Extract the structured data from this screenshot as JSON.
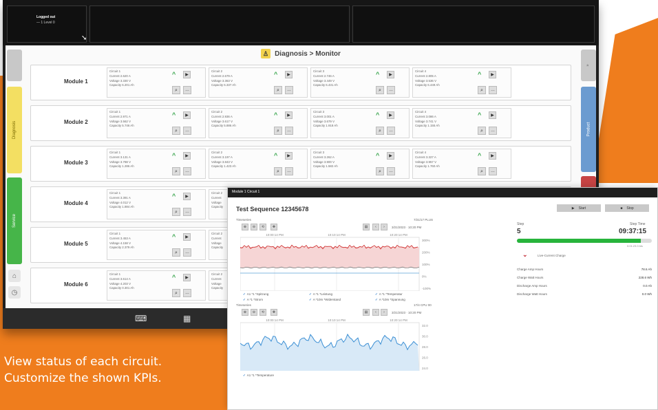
{
  "colors": {
    "accent_orange": "#ef7d1d",
    "tab_yellow": "#f3df62",
    "tab_green": "#46b549",
    "tab_blue": "#6b9bd0",
    "tab_red": "#c74444",
    "up_green": "#2ea043",
    "progress_green": "#27b43c",
    "line_red": "#d23c3c",
    "line_blue": "#3b8fd4"
  },
  "topbar": {
    "status_title": "Logged out",
    "status_sub": "— 1 Level 0"
  },
  "screen": {
    "breadcrumb": "Diagnosis > Monitor"
  },
  "side_tabs": {
    "left_yellow": "Diagnosis",
    "left_green": "Service",
    "right_blue": "Product"
  },
  "modules": [
    {
      "name": "Module 1",
      "circuits": [
        {
          "title": "Circuit 1",
          "current": "Current 2.620 A",
          "voltage": "Voltage 3.330 V",
          "capacity": "Capacity 6.201 Ah"
        },
        {
          "title": "Circuit 2",
          "current": "Current 2.679 A",
          "voltage": "Voltage 3.363 V",
          "capacity": "Capacity 6.337 Ah"
        },
        {
          "title": "Circuit 3",
          "current": "Current 2.746 A",
          "voltage": "Voltage 3.449 V",
          "capacity": "Capacity 6.431 Ah"
        },
        {
          "title": "Circuit 4",
          "current": "Current 2.805 A",
          "voltage": "Voltage 3.536 V",
          "capacity": "Capacity 6.449 Ah"
        }
      ]
    },
    {
      "name": "Module 2",
      "circuits": [
        {
          "title": "Circuit 1",
          "current": "Current 2.971 A",
          "voltage": "Voltage 3.562 V",
          "capacity": "Capacity 5.746 Ah"
        },
        {
          "title": "Circuit 2",
          "current": "Current 2.936 A",
          "voltage": "Voltage 3.617 V",
          "capacity": "Capacity 5.886 Ah"
        },
        {
          "title": "Circuit 3",
          "current": "Current 3.001 A",
          "voltage": "Voltage 3.679 V",
          "capacity": "Capacity 1.918 Ah"
        },
        {
          "title": "Circuit 4",
          "current": "Current 3.086 A",
          "voltage": "Voltage 3.741 V",
          "capacity": "Capacity 1.155 Ah"
        }
      ]
    },
    {
      "name": "Module 3",
      "circuits": [
        {
          "title": "Circuit 1",
          "current": "Current 3.131 A",
          "voltage": "Voltage 3.788 V",
          "capacity": "Capacity 1.286 Ah"
        },
        {
          "title": "Circuit 2",
          "current": "Current 3.197 A",
          "voltage": "Voltage 3.843 V",
          "capacity": "Capacity 1.423 Ah"
        },
        {
          "title": "Circuit 3",
          "current": "Current 3.262 A",
          "voltage": "Voltage 3.900 V",
          "capacity": "Capacity 1.582 Ah"
        },
        {
          "title": "Circuit 4",
          "current": "Current 3.327 A",
          "voltage": "Voltage 3.957 V",
          "capacity": "Capacity 1.760 Ah"
        }
      ]
    },
    {
      "name": "Module 4",
      "circuits": [
        {
          "title": "Circuit 1",
          "current": "Current 3.391 A",
          "voltage": "Voltage 4.012 V",
          "capacity": "Capacity 1.884 Ah"
        },
        {
          "title": "Circuit 2",
          "current": "Current",
          "voltage": "Voltage",
          "capacity": "Capacity"
        }
      ]
    },
    {
      "name": "Module 5",
      "circuits": [
        {
          "title": "Circuit 1",
          "current": "Current 3.453 A",
          "voltage": "Voltage 4.158 V",
          "capacity": "Capacity 2.379 Ah"
        },
        {
          "title": "Circuit 2",
          "current": "Current",
          "voltage": "Voltage",
          "capacity": "Capacity"
        }
      ]
    },
    {
      "name": "Module 6",
      "circuits": [
        {
          "title": "Circuit 1",
          "current": "Current 3.614 A",
          "voltage": "Voltage 4.203 V",
          "capacity": "Capacity 0.301 Ah"
        },
        {
          "title": "Circuit 2",
          "current": "Current",
          "voltage": "Voltage",
          "capacity": "Capacity"
        }
      ]
    }
  ],
  "popup": {
    "title": "Module 1 Circuit 1",
    "sequence": "Test Sequence 12345678",
    "start_label": "Start",
    "stop_label": "Stop",
    "chart1": {
      "label": "Timeseries",
      "top_right": "7/21/17 PLUS",
      "date": "3/21/2023 · 10:20 PM",
      "time_ticks": [
        "10:00:14 PM",
        "10:10:14 PM",
        "10:20:14 PM"
      ],
      "y_ticks": [
        "300%",
        "200%",
        "100%",
        "0%",
        "-100%"
      ],
      "legend": [
        "A1 *1 *Spitzung",
        "A *1 *Leistung",
        "A *1 *Temperatur",
        "A *1 *Strom",
        "A *10m *Widerstand",
        "A *10m *Spannung"
      ]
    },
    "chart2": {
      "label": "Timeseries",
      "top_right": "17/4 CPU 00",
      "date": "3/21/2023 · 10:20 PM",
      "time_ticks": [
        "10:00:14 PM",
        "10:10:14 PM",
        "10:20:14 PM"
      ],
      "y_ticks": [
        "32.0",
        "30.0",
        "28.0",
        "26.0",
        "24.0"
      ],
      "legend": [
        "A1 *1 *Temperature"
      ]
    },
    "step_label": "Step",
    "step_value": "5",
    "steptime_label": "Step Time",
    "steptime_value": "09:37:15",
    "progress_fraction": 0.92,
    "progress_sub": "0:01:23:3 bis",
    "expand_label": "Live-Current Charge",
    "kpis": [
      {
        "label": "Charge Amp Hours",
        "value": "78.6 Ah"
      },
      {
        "label": "Charge Watt Hours",
        "value": "228.6 Wh"
      },
      {
        "label": "Discharge Amp Hours",
        "value": "0.0 Ah"
      },
      {
        "label": "Discharge Watt Hours",
        "value": "0.0 Wh"
      }
    ]
  },
  "caption": {
    "line1": "View status of each circuit.",
    "line2": "Customize the shown KPIs."
  }
}
